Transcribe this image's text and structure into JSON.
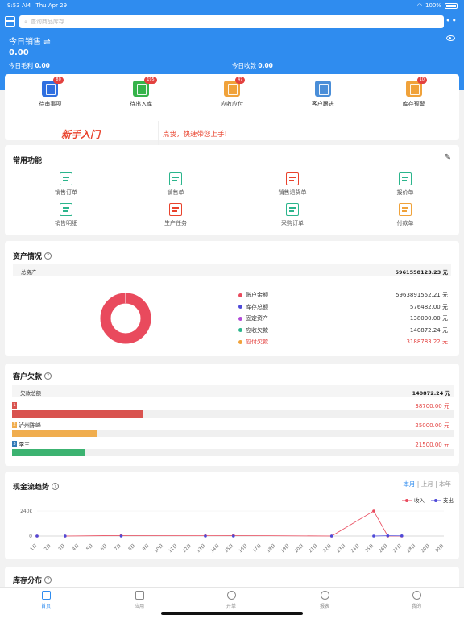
{
  "status": {
    "time": "9:53 AM",
    "date": "Thu Apr 29",
    "battery": "100%"
  },
  "search": {
    "placeholder": "查询商品库存"
  },
  "header": {
    "title": "今日销售",
    "value": "0.00",
    "gross_label": "今日毛利",
    "gross_value": "0.00",
    "receipt_label": "今日收款",
    "receipt_value": "0.00"
  },
  "quick": [
    {
      "label": "待审事项",
      "badge": "80",
      "color": "#2f6fe0"
    },
    {
      "label": "待出入库",
      "badge": "195",
      "color": "#35b34a"
    },
    {
      "label": "应收应付",
      "badge": "47",
      "color": "#f0a23a"
    },
    {
      "label": "客户跟进",
      "badge": "",
      "color": "#4a8ed8"
    },
    {
      "label": "库存预警",
      "badge": "10",
      "color": "#f0a23a"
    }
  ],
  "newbie": {
    "logo": "新手入门",
    "text": "点我，快速带您上手!"
  },
  "functions": {
    "title": "常用功能",
    "items": [
      {
        "label": "销售订单",
        "color": "#2bb58c"
      },
      {
        "label": "销售单",
        "color": "#2bb58c"
      },
      {
        "label": "销售退货单",
        "color": "#e9422c"
      },
      {
        "label": "报价单",
        "color": "#2bb58c"
      },
      {
        "label": "销售明细",
        "color": "#2bb58c"
      },
      {
        "label": "生产任务",
        "color": "#e9422c"
      },
      {
        "label": "采购订单",
        "color": "#2bb58c"
      },
      {
        "label": "付款单",
        "color": "#f0a23a"
      }
    ]
  },
  "assets": {
    "title": "资产情况",
    "total_label": "总资产",
    "total_value": "5961558123.23 元",
    "items": [
      {
        "label": "账户余额",
        "value": "5963891552.21 元",
        "color": "#e94a5d"
      },
      {
        "label": "库存总额",
        "value": "576482.00 元",
        "color": "#4f4ad8"
      },
      {
        "label": "固定资产",
        "value": "138000.00 元",
        "color": "#b14ad8"
      },
      {
        "label": "应收欠款",
        "value": "140872.24 元",
        "color": "#2bb58c"
      },
      {
        "label": "应付欠款",
        "value": "3188783.22 元",
        "color": "#f0a23a",
        "negative": true
      }
    ]
  },
  "debt": {
    "title": "客户欠款",
    "total_label": "欠款总额",
    "total_value": "140872.24 元",
    "items": [
      {
        "rank": "1",
        "name": "",
        "value": "38700.00 元",
        "amount": 38700,
        "color": "#d9534f"
      },
      {
        "rank": "2",
        "name": "泸州陈峰",
        "value": "25000.00 元",
        "amount": 25000,
        "color": "#f0ad4e"
      },
      {
        "rank": "3",
        "name": "李三",
        "value": "21500.00 元",
        "amount": 21500,
        "color": "#337ab7"
      }
    ],
    "track_color": "#3cb371"
  },
  "cashflow": {
    "title": "现金流趋势",
    "periods": [
      "本月",
      "上月",
      "本年"
    ],
    "legend": [
      "收入",
      "支出"
    ]
  },
  "chart_data": {
    "type": "line",
    "x": [
      "1日",
      "2日",
      "3日",
      "4日",
      "5日",
      "6日",
      "7日",
      "8日",
      "9日",
      "10日",
      "11日",
      "12日",
      "13日",
      "14日",
      "15日",
      "16日",
      "17日",
      "18日",
      "19日",
      "20日",
      "21日",
      "22日",
      "23日",
      "24日",
      "25日",
      "26日",
      "27日",
      "28日",
      "29日",
      "30日"
    ],
    "yticks": [
      "240k",
      "0"
    ],
    "ylim": [
      0,
      240000
    ],
    "series": [
      {
        "name": "收入",
        "color": "#e94a5d",
        "points": [
          [
            1,
            0
          ],
          [
            3,
            0
          ],
          [
            7,
            5000
          ],
          [
            13,
            3000
          ],
          [
            15,
            5000
          ],
          [
            22,
            0
          ],
          [
            25,
            240000
          ],
          [
            26,
            0
          ],
          [
            27,
            0
          ]
        ]
      },
      {
        "name": "支出",
        "color": "#4f4ad8",
        "points": [
          [
            1,
            0
          ],
          [
            3,
            0
          ],
          [
            7,
            0
          ],
          [
            13,
            0
          ],
          [
            15,
            0
          ],
          [
            22,
            0
          ],
          [
            25,
            0
          ],
          [
            26,
            3000
          ],
          [
            27,
            2000
          ]
        ]
      }
    ]
  },
  "inventory": {
    "title": "库存分布"
  },
  "nav": [
    {
      "label": "首页",
      "active": true
    },
    {
      "label": "应用",
      "active": false
    },
    {
      "label": "开单",
      "active": false
    },
    {
      "label": "报表",
      "active": false
    },
    {
      "label": "我的",
      "active": false
    }
  ]
}
